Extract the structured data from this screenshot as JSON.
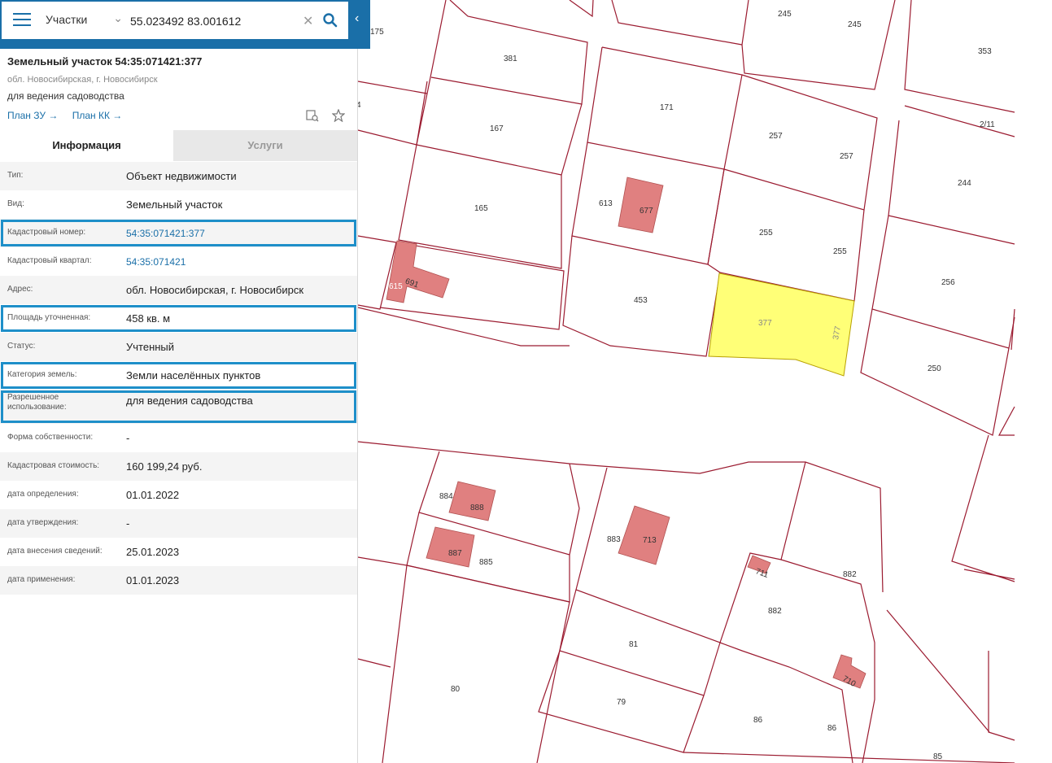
{
  "search": {
    "layer": "Участки",
    "query": "55.023492 83.001612"
  },
  "parcel": {
    "title": "Земельный участок 54:35:071421:377",
    "address": "обл. Новосибирская, г. Новосибирск",
    "usage": "для ведения садоводства",
    "link_plan_zu": "План ЗУ →",
    "link_plan_kk": "План КК →"
  },
  "tabs": {
    "info": "Информация",
    "services": "Услуги"
  },
  "rows": [
    {
      "label": "Тип:",
      "value": "Объект недвижимости"
    },
    {
      "label": "Вид:",
      "value": "Земельный участок"
    },
    {
      "label": "Кадастровый номер:",
      "value": "54:35:071421:377"
    },
    {
      "label": "Кадастровый квартал:",
      "value": "54:35:071421"
    },
    {
      "label": "Адрес:",
      "value": "обл. Новосибирская, г. Новосибирск"
    },
    {
      "label": "Площадь уточненная:",
      "value": "458 кв. м"
    },
    {
      "label": "Статус:",
      "value": "Учтенный"
    },
    {
      "label": "Категория земель:",
      "value": "Земли населённых пунктов"
    },
    {
      "label": "Разрешенное использование:",
      "value": "для ведения садоводства"
    },
    {
      "label": "Форма собственности:",
      "value": "-"
    },
    {
      "label": "Кадастровая стоимость:",
      "value": "160 199,24 руб."
    },
    {
      "label": "дата определения:",
      "value": "01.01.2022"
    },
    {
      "label": "дата утверждения:",
      "value": "-"
    },
    {
      "label": "дата внесения сведений:",
      "value": "25.01.2023"
    },
    {
      "label": "дата применения:",
      "value": "01.01.2023"
    }
  ],
  "map_labels": [
    "175",
    "381",
    "245",
    "245",
    "353",
    "171",
    "167",
    "257",
    "257",
    "2/11",
    "165",
    "613",
    "677",
    "244",
    "255",
    "255",
    "615",
    "691",
    "453",
    "377",
    "377",
    "256",
    "250",
    "884",
    "888",
    "883",
    "713",
    "887",
    "885",
    "711",
    "882",
    "882",
    "81",
    "80",
    "79",
    "710",
    "86",
    "86",
    "85",
    "4"
  ],
  "colors": {
    "accent": "#1a6fa8",
    "highlight_frame": "#1e8fc9",
    "parcel_border": "#9b1b30",
    "selected_parcel": "#ffff77",
    "building": "#e08080"
  }
}
